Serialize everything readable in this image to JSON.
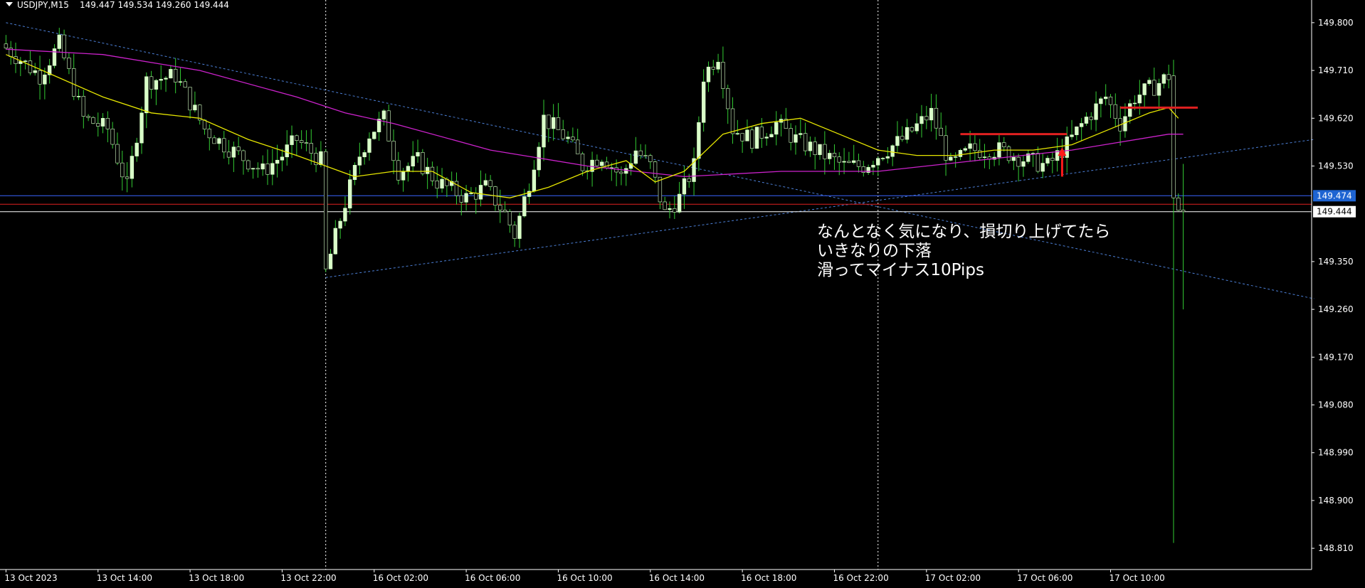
{
  "header": {
    "symbol_tf": "USDJPY,M15",
    "ohlc": "149.447 149.534 149.260 149.444"
  },
  "annotation": {
    "lines": [
      "なんとなく気になり、損切り上げてたら",
      "いきなりの下落",
      "滑ってマイナス10Pips"
    ]
  },
  "colors": {
    "background": "#000000",
    "bull_candle": "#d9ffc8",
    "bear_candle": "#00c800",
    "wick": "#33cc33",
    "ma_fast": "#e6e600",
    "ma_slow": "#cc22cc",
    "trendline": "#4c7fd6",
    "hline_blue": "#3a66ff",
    "hline_red": "#e02020",
    "marker_red": "#ff1a1a",
    "axis_text": "#ffffff",
    "badge_blue": "#1e64d2"
  },
  "chart_data": {
    "type": "candlestick",
    "symbol": "USDJPY",
    "timeframe": "M15",
    "y_axis": {
      "min": 148.77,
      "max": 149.84,
      "ticks": [
        149.8,
        149.71,
        149.62,
        149.53,
        149.35,
        149.26,
        149.17,
        149.08,
        148.99,
        148.9,
        148.81
      ],
      "tick_labels": [
        "149.800",
        "149.710",
        "149.620",
        "149.530",
        "149.350",
        "149.260",
        "149.170",
        "149.080",
        "148.990",
        "148.900",
        "148.810"
      ]
    },
    "x_axis": {
      "bar_count": 270,
      "tick_labels": [
        "13 Oct 2023",
        "13 Oct 14:00",
        "13 Oct 18:00",
        "13 Oct 22:00",
        "16 Oct 02:00",
        "16 Oct 06:00",
        "16 Oct 10:00",
        "16 Oct 14:00",
        "16 Oct 18:00",
        "16 Oct 22:00",
        "17 Oct 02:00",
        "17 Oct 06:00",
        "17 Oct 10:00"
      ],
      "tick_bar_index": [
        0,
        19,
        38,
        57,
        76,
        95,
        114,
        133,
        152,
        171,
        190,
        209,
        228
      ],
      "dotted_separators_at_bar": [
        66,
        180
      ]
    },
    "price_path": [
      [
        0,
        149.76
      ],
      [
        8,
        149.7
      ],
      [
        12,
        149.76
      ],
      [
        17,
        149.62
      ],
      [
        22,
        149.6
      ],
      [
        26,
        149.49
      ],
      [
        30,
        149.69
      ],
      [
        36,
        149.7
      ],
      [
        42,
        149.6
      ],
      [
        46,
        149.57
      ],
      [
        54,
        149.52
      ],
      [
        58,
        149.55
      ],
      [
        61,
        149.58
      ],
      [
        66,
        149.54
      ],
      [
        67,
        149.33
      ],
      [
        70,
        149.43
      ],
      [
        74,
        149.55
      ],
      [
        76,
        149.59
      ],
      [
        79,
        149.62
      ],
      [
        82,
        149.52
      ],
      [
        86,
        149.54
      ],
      [
        90,
        149.5
      ],
      [
        96,
        149.47
      ],
      [
        100,
        149.49
      ],
      [
        104,
        149.44
      ],
      [
        106,
        149.4
      ],
      [
        109,
        149.5
      ],
      [
        112,
        149.62
      ],
      [
        117,
        149.58
      ],
      [
        120,
        149.53
      ],
      [
        124,
        149.55
      ],
      [
        128,
        149.51
      ],
      [
        131,
        149.56
      ],
      [
        134,
        149.53
      ],
      [
        137,
        149.44
      ],
      [
        140,
        149.47
      ],
      [
        143,
        149.53
      ],
      [
        145,
        149.7
      ],
      [
        148,
        149.74
      ],
      [
        151,
        149.6
      ],
      [
        155,
        149.58
      ],
      [
        160,
        149.61
      ],
      [
        164,
        149.58
      ],
      [
        168,
        149.56
      ],
      [
        174,
        149.53
      ],
      [
        178,
        149.53
      ],
      [
        181,
        149.55
      ],
      [
        186,
        149.58
      ],
      [
        192,
        149.63
      ],
      [
        196,
        149.53
      ],
      [
        200,
        149.56
      ],
      [
        206,
        149.56
      ],
      [
        212,
        149.54
      ],
      [
        216,
        149.53
      ],
      [
        220,
        149.57
      ],
      [
        224,
        149.62
      ],
      [
        228,
        149.66
      ],
      [
        231,
        149.61
      ],
      [
        234,
        149.66
      ],
      [
        238,
        149.68
      ],
      [
        241,
        149.7
      ],
      [
        242,
        149.47
      ],
      [
        243,
        149.447
      ]
    ],
    "last_bar": {
      "open": 149.447,
      "high": 149.534,
      "low": 149.26,
      "close": 149.444
    },
    "spike": {
      "bar": 241,
      "high": 149.73,
      "low": 148.82
    },
    "ma_fast_path": [
      [
        0,
        149.74
      ],
      [
        10,
        149.7
      ],
      [
        20,
        149.66
      ],
      [
        30,
        149.63
      ],
      [
        40,
        149.62
      ],
      [
        50,
        149.58
      ],
      [
        60,
        149.55
      ],
      [
        66,
        149.53
      ],
      [
        72,
        149.51
      ],
      [
        80,
        149.52
      ],
      [
        88,
        149.52
      ],
      [
        96,
        149.48
      ],
      [
        104,
        149.47
      ],
      [
        112,
        149.49
      ],
      [
        120,
        149.52
      ],
      [
        128,
        149.54
      ],
      [
        134,
        149.5
      ],
      [
        140,
        149.52
      ],
      [
        148,
        149.59
      ],
      [
        156,
        149.61
      ],
      [
        164,
        149.62
      ],
      [
        172,
        149.59
      ],
      [
        180,
        149.56
      ],
      [
        188,
        149.55
      ],
      [
        196,
        149.55
      ],
      [
        204,
        149.56
      ],
      [
        212,
        149.56
      ],
      [
        220,
        149.57
      ],
      [
        228,
        149.6
      ],
      [
        236,
        149.63
      ],
      [
        240,
        149.64
      ],
      [
        242,
        149.62
      ]
    ],
    "ma_slow_path": [
      [
        0,
        149.75
      ],
      [
        20,
        149.74
      ],
      [
        40,
        149.71
      ],
      [
        60,
        149.66
      ],
      [
        70,
        149.63
      ],
      [
        80,
        149.61
      ],
      [
        100,
        149.56
      ],
      [
        120,
        149.53
      ],
      [
        140,
        149.51
      ],
      [
        160,
        149.52
      ],
      [
        180,
        149.52
      ],
      [
        200,
        149.54
      ],
      [
        220,
        149.56
      ],
      [
        240,
        149.59
      ],
      [
        243,
        149.59
      ]
    ],
    "trendlines": [
      {
        "from": [
          0,
          149.8
        ],
        "to": [
          270,
          149.28
        ],
        "style": "dashed"
      },
      {
        "from": [
          66,
          149.32
        ],
        "to": [
          270,
          149.58
        ],
        "style": "dashed"
      }
    ],
    "hlines": [
      {
        "price": 149.474,
        "color": "blue",
        "label": "149.474"
      },
      {
        "price": 149.458,
        "color": "red"
      },
      {
        "price": 149.444,
        "color": "white",
        "label": "149.444"
      }
    ],
    "segments": [
      {
        "from": [
          197,
          149.59
        ],
        "to": [
          219,
          149.59
        ],
        "color": "red"
      },
      {
        "from": [
          230,
          149.64
        ],
        "to": [
          246,
          149.64
        ],
        "color": "red"
      }
    ],
    "arrow": {
      "bar": 218,
      "from_price": 149.51,
      "to_price": 149.56,
      "color": "red"
    }
  }
}
